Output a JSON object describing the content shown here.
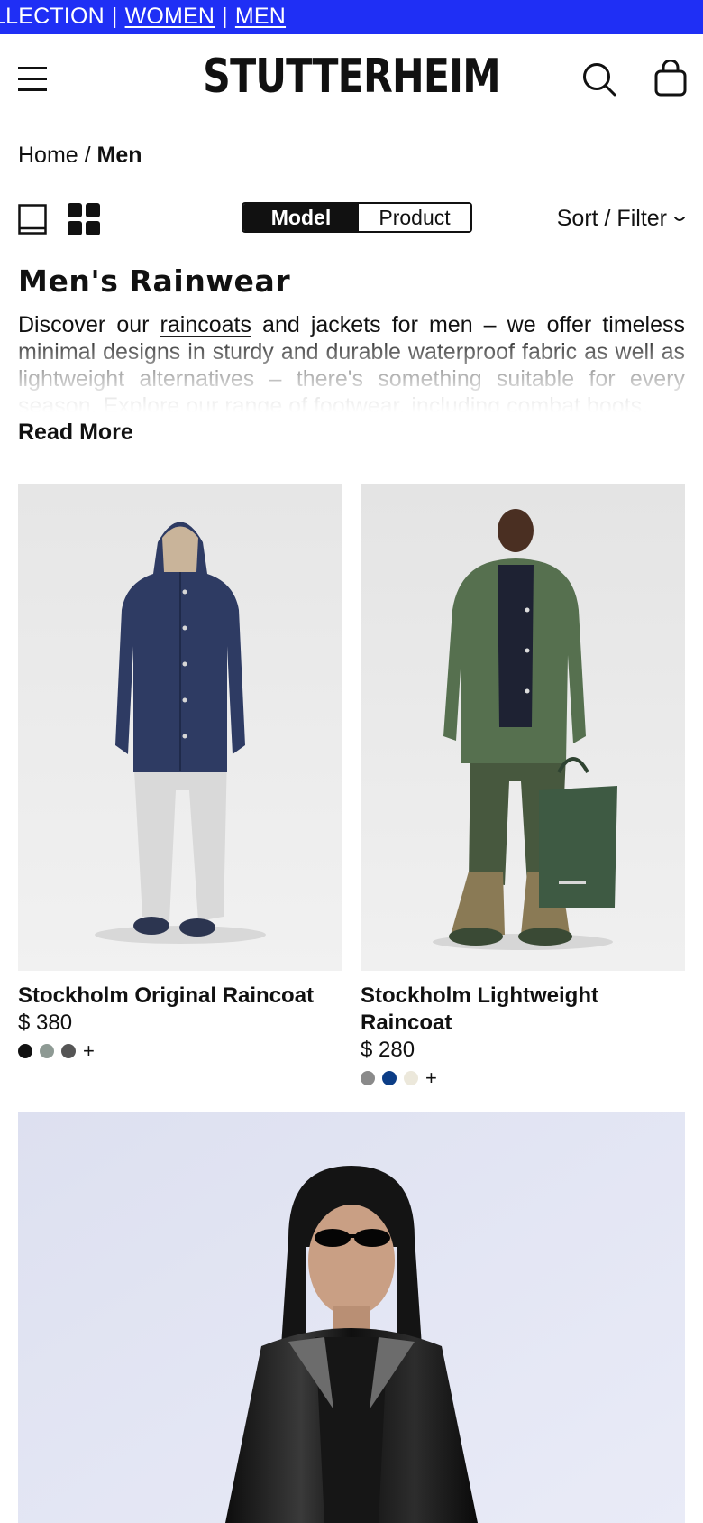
{
  "promo": {
    "prefix": "LLECTION",
    "separator": "|",
    "links": [
      "WOMEN",
      "MEN"
    ]
  },
  "header": {
    "logo": "STUTTERHEIM",
    "menu_icon": "hamburger-menu-icon",
    "search_icon": "search-icon",
    "bag_icon": "shopping-bag-icon"
  },
  "breadcrumb": {
    "home": "Home",
    "separator": "/",
    "current": "Men"
  },
  "controls": {
    "view_single_icon": "single-column-view-icon",
    "view_grid_icon": "grid-view-icon",
    "toggle": {
      "model": "Model",
      "product": "Product",
      "selected": "Model"
    },
    "sort_filter": "Sort / Filter"
  },
  "page": {
    "title": "Men's Rainwear",
    "intro_before": "Discover our ",
    "intro_link": "raincoats",
    "intro_after": " and jackets for men – we offer timeless minimal designs in sturdy and durable waterproof fabric as well as lightweight alternatives – there's something suitable for every season. Explore our range of footwear, including combat boots.",
    "read_more": "Read More"
  },
  "products": [
    {
      "name": "Stockholm Original Raincoat",
      "price": "$ 380",
      "swatches": [
        "#111111",
        "#8e9a94",
        "#555555"
      ],
      "more": "+"
    },
    {
      "name": "Stockholm Lightweight Raincoat",
      "price": "$ 280",
      "swatches": [
        "#8a8a8a",
        "#0c3d86",
        "#ece8db"
      ],
      "more": "+"
    }
  ],
  "colors": {
    "promo_bg": "#1f2ff5",
    "text": "#111111"
  }
}
